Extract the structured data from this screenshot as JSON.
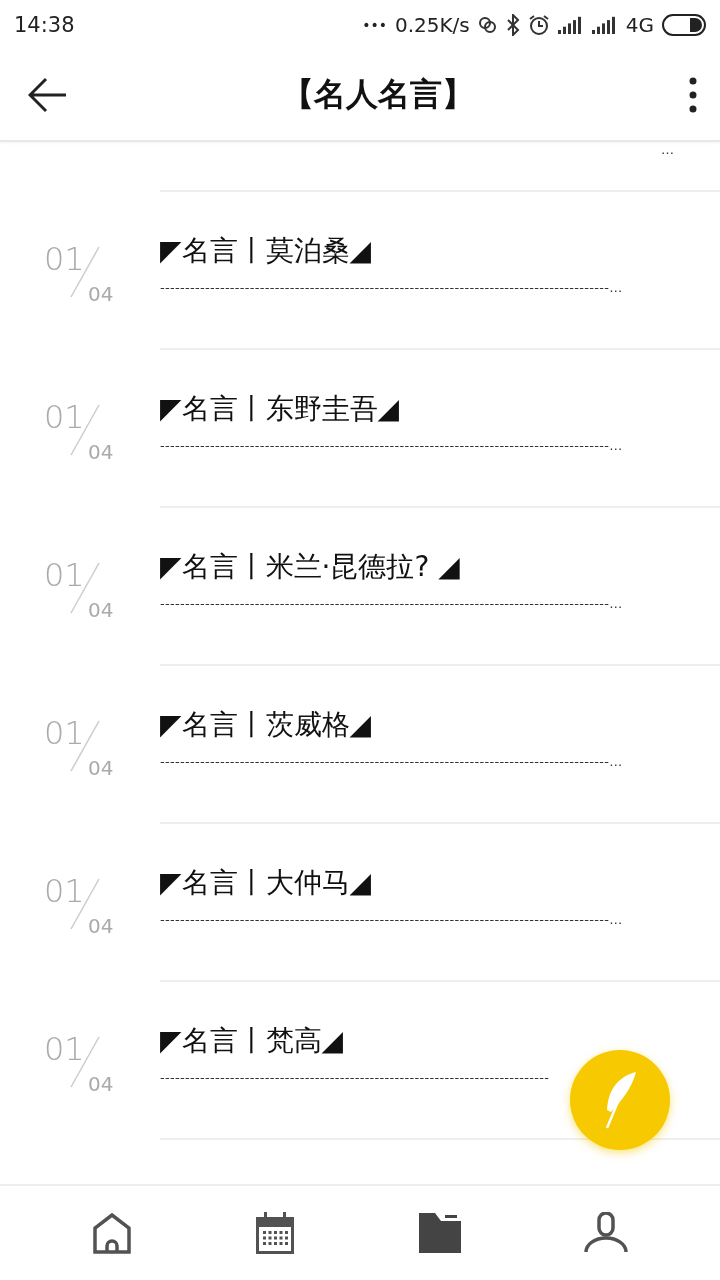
{
  "status_bar": {
    "time": "14:38",
    "more": "•••",
    "speed": "0.25K/s",
    "network": "4G"
  },
  "header": {
    "title": "【名人名言】"
  },
  "top_fragment": "…",
  "quotes": [
    {
      "index": "01",
      "total": "04",
      "title": "◤名言丨莫泊桑◢",
      "excerpt": "------------------------------------------------------------------------------------------…"
    },
    {
      "index": "01",
      "total": "04",
      "title": "◤名言丨东野圭吾◢",
      "excerpt": "------------------------------------------------------------------------------------------…"
    },
    {
      "index": "01",
      "total": "04",
      "title": "◤名言丨米兰·昆德拉? ◢",
      "excerpt": "------------------------------------------------------------------------------------------…"
    },
    {
      "index": "01",
      "total": "04",
      "title": "◤名言丨茨威格◢",
      "excerpt": "------------------------------------------------------------------------------------------…"
    },
    {
      "index": "01",
      "total": "04",
      "title": "◤名言丨大仲马◢",
      "excerpt": "------------------------------------------------------------------------------------------…"
    },
    {
      "index": "01",
      "total": "04",
      "title": "◤名言丨梵高◢",
      "excerpt": "------------------------------------------------------------------------------"
    }
  ],
  "nav": [
    {
      "kind": "home",
      "selected": false
    },
    {
      "kind": "calendar",
      "selected": false
    },
    {
      "kind": "folder",
      "selected": true
    },
    {
      "kind": "person",
      "selected": false
    }
  ]
}
